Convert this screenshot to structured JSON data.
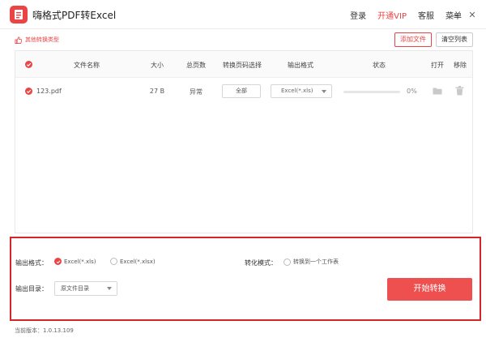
{
  "app": {
    "title": "嗨格式PDF转Excel",
    "menu": {
      "login": "登录",
      "vip": "开通VIP",
      "service": "客服",
      "menu": "菜单"
    },
    "window_controls": {
      "minimize": "—",
      "close": "✕"
    }
  },
  "toolbar": {
    "other_types": "其他转换类型",
    "add_file": "添加文件",
    "clear_list": "清空列表"
  },
  "table": {
    "headers": {
      "filename": "文件名称",
      "size": "大小",
      "pages": "总页数",
      "range": "转换页码选择",
      "format": "输出格式",
      "status": "状态",
      "open": "打开",
      "remove": "移除"
    },
    "rows": [
      {
        "name": "123.pdf",
        "size": "27 B",
        "pages": "异常",
        "range": "全部",
        "format": "Excel(*.xls)",
        "progress": 0,
        "progress_text": "0%"
      }
    ]
  },
  "settings": {
    "output_format_label": "输出格式：",
    "format_options": [
      "Excel(*.xls)",
      "Excel(*.xlsx)"
    ],
    "selected_format": "Excel(*.xls)",
    "convert_mode_label": "转化模式：",
    "convert_mode_option": "转换到一个工作表",
    "output_dir_label": "输出目录：",
    "output_dir_value": "原文件目录",
    "start_button": "开始转换"
  },
  "footer": {
    "version": "当前版本：1.0.13.109"
  },
  "colors": {
    "accent": "#e94545",
    "highlight_border": "#d2262a"
  }
}
